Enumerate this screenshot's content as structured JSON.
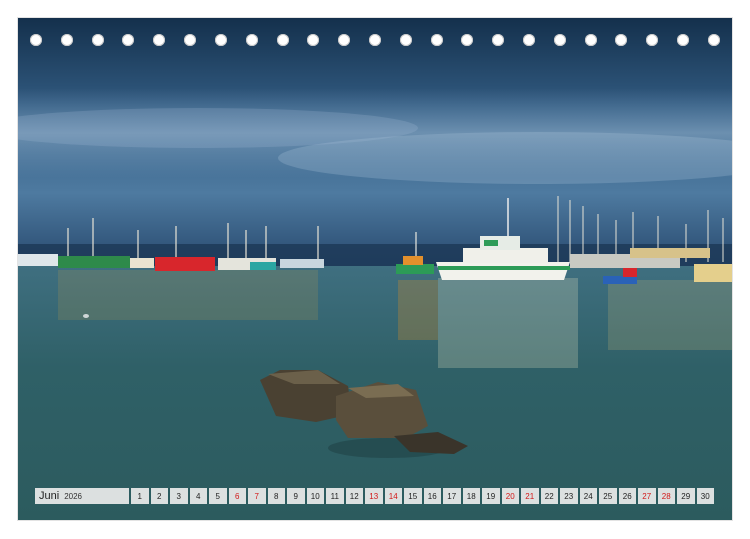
{
  "calendar": {
    "month": "Juni",
    "year": "2026",
    "days": [
      {
        "n": "1",
        "weekend": false
      },
      {
        "n": "2",
        "weekend": false
      },
      {
        "n": "3",
        "weekend": false
      },
      {
        "n": "4",
        "weekend": false
      },
      {
        "n": "5",
        "weekend": false
      },
      {
        "n": "6",
        "weekend": true
      },
      {
        "n": "7",
        "weekend": true
      },
      {
        "n": "8",
        "weekend": false
      },
      {
        "n": "9",
        "weekend": false
      },
      {
        "n": "10",
        "weekend": false
      },
      {
        "n": "11",
        "weekend": false
      },
      {
        "n": "12",
        "weekend": false
      },
      {
        "n": "13",
        "weekend": true
      },
      {
        "n": "14",
        "weekend": true
      },
      {
        "n": "15",
        "weekend": false
      },
      {
        "n": "16",
        "weekend": false
      },
      {
        "n": "17",
        "weekend": false
      },
      {
        "n": "18",
        "weekend": false
      },
      {
        "n": "19",
        "weekend": false
      },
      {
        "n": "20",
        "weekend": true
      },
      {
        "n": "21",
        "weekend": true
      },
      {
        "n": "22",
        "weekend": false
      },
      {
        "n": "23",
        "weekend": false
      },
      {
        "n": "24",
        "weekend": false
      },
      {
        "n": "25",
        "weekend": false
      },
      {
        "n": "26",
        "weekend": false
      },
      {
        "n": "27",
        "weekend": true
      },
      {
        "n": "28",
        "weekend": true
      },
      {
        "n": "29",
        "weekend": false
      },
      {
        "n": "30",
        "weekend": false
      }
    ]
  },
  "binding": {
    "hole_count": 23
  },
  "colors": {
    "weekend_text": "#d21919",
    "cell_bg": "#ebebeb",
    "sky_top": "#0f2a45",
    "water": "#2f5e66"
  }
}
